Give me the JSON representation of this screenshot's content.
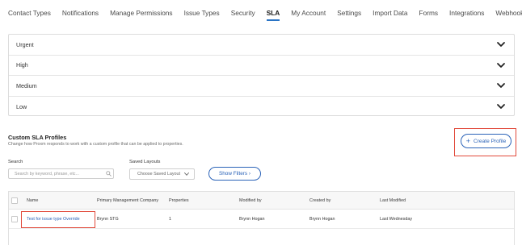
{
  "tabs": [
    {
      "label": "Contact Types",
      "active": false
    },
    {
      "label": "Notifications",
      "active": false
    },
    {
      "label": "Manage Permissions",
      "active": false
    },
    {
      "label": "Issue Types",
      "active": false
    },
    {
      "label": "Security",
      "active": false
    },
    {
      "label": "SLA",
      "active": true
    },
    {
      "label": "My Account",
      "active": false
    },
    {
      "label": "Settings",
      "active": false
    },
    {
      "label": "Import Data",
      "active": false
    },
    {
      "label": "Forms",
      "active": false
    },
    {
      "label": "Integrations",
      "active": false
    },
    {
      "label": "Webhooks",
      "active": false
    }
  ],
  "priorities": [
    "Urgent",
    "High",
    "Medium",
    "Low"
  ],
  "profiles": {
    "title": "Custom SLA Profiles",
    "description": "Change how Proxm responds to work with a custom profile that can be applied to properties.",
    "create_label": "Create Profile",
    "create_icon": "plus-icon"
  },
  "filters": {
    "search_label": "Search",
    "search_placeholder": "Search by keyword, phrase, etc...",
    "layouts_label": "Saved Layouts",
    "layouts_value": "Choose Saved Layout",
    "show_filters_label": "Show Filters ›"
  },
  "table": {
    "columns": [
      "Name",
      "Primary Management Company",
      "Properties",
      "Modified by",
      "Created by",
      "Last Modified"
    ],
    "rows": [
      {
        "name": "Test for issue type Override",
        "company": "Brynn STG",
        "properties": "1",
        "modified_by": "Brynn Hogan",
        "created_by": "Brynn Hogan",
        "last_modified": "Last Wednesday"
      }
    ]
  },
  "colors": {
    "accent": "#2b63b8",
    "highlight": "#e14a3b",
    "active_tab_underline": "#2a74c5"
  }
}
